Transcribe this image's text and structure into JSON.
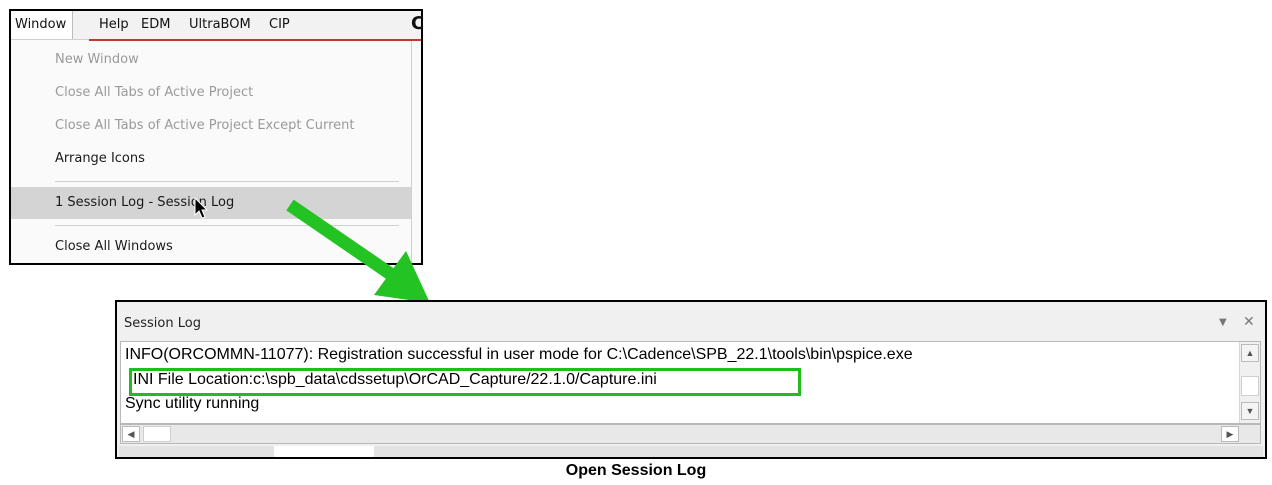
{
  "menubar": {
    "items": [
      "Window",
      "Help",
      "EDM",
      "UltraBOM",
      "CIP"
    ],
    "truncated_glyph": "C"
  },
  "window_menu": {
    "items": [
      {
        "label": "New Window",
        "enabled": false
      },
      {
        "label": "Close All Tabs of Active Project",
        "enabled": false
      },
      {
        "label": "Close All Tabs of Active Project Except Current",
        "enabled": false
      },
      {
        "label": "Arrange Icons",
        "enabled": true
      },
      {
        "label": "1 Session Log - Session Log",
        "enabled": true,
        "highlighted": true
      },
      {
        "label": "Close All Windows",
        "enabled": true
      }
    ]
  },
  "arrow_color": "#22c322",
  "session_log": {
    "title": "Session Log",
    "lines": [
      "INFO(ORCOMMN-11077): Registration successful in user mode for C:\\Cadence\\SPB_22.1\\tools\\bin\\pspice.exe",
      "INI File Location:c:\\spb_data\\cdssetup\\OrCAD_Capture/22.1.0/Capture.ini",
      "Sync utility running"
    ],
    "highlight_color": "#22bb22"
  },
  "caption": "Open Session Log"
}
